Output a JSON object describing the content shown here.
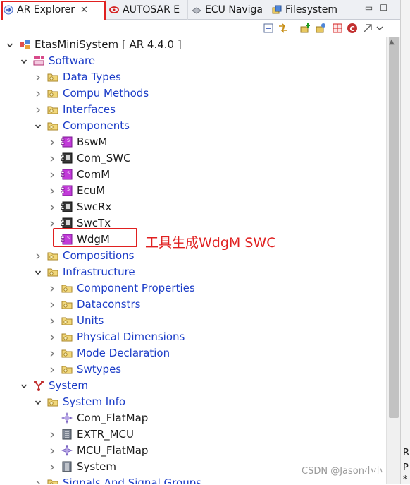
{
  "tabs": [
    {
      "label": "AR Explorer",
      "icon": "arrow-icon",
      "closable": true
    },
    {
      "label": "AUTOSAR E",
      "icon": "autosar-icon"
    },
    {
      "label": "ECU Naviga",
      "icon": "ecu-nav-icon"
    },
    {
      "label": "Filesystem",
      "icon": "filesystem-icon"
    }
  ],
  "window_buttons": {
    "minimize": "▭",
    "maximize": "☐"
  },
  "tree": [
    {
      "label": "EtasMiniSystem [ AR 4.4.0 ]",
      "color": "black",
      "icon": "project-icon",
      "expanded": true
    },
    {
      "label": "Software",
      "color": "blue",
      "icon": "software-icon",
      "expanded": true
    },
    {
      "label": "Data Types",
      "color": "blue",
      "icon": "package-folder-icon",
      "expanded": false
    },
    {
      "label": "Compu Methods",
      "color": "blue",
      "icon": "package-folder-icon",
      "expanded": false
    },
    {
      "label": "Interfaces",
      "color": "blue",
      "icon": "package-folder-icon",
      "expanded": false
    },
    {
      "label": "Components",
      "color": "blue",
      "icon": "package-folder-icon",
      "expanded": true
    },
    {
      "label": "BswM",
      "color": "black",
      "icon": "bsw-component-icon",
      "expanded": false
    },
    {
      "label": "Com_SWC",
      "color": "black",
      "icon": "swc-component-icon",
      "expanded": false
    },
    {
      "label": "ComM",
      "color": "black",
      "icon": "bsw-component-icon",
      "expanded": false
    },
    {
      "label": "EcuM",
      "color": "black",
      "icon": "bsw-component-icon",
      "expanded": false
    },
    {
      "label": "SwcRx",
      "color": "black",
      "icon": "swc-component-icon",
      "expanded": false
    },
    {
      "label": "SwcTx",
      "color": "black",
      "icon": "swc-component-icon",
      "expanded": false
    },
    {
      "label": "WdgM",
      "color": "black",
      "icon": "bsw-component-icon",
      "expanded": null
    },
    {
      "label": "Compositions",
      "color": "blue",
      "icon": "package-folder-icon",
      "expanded": false
    },
    {
      "label": "Infrastructure",
      "color": "blue",
      "icon": "package-folder-icon",
      "expanded": true
    },
    {
      "label": "Component Properties",
      "color": "blue",
      "icon": "package-folder-icon",
      "expanded": false
    },
    {
      "label": "Dataconstrs",
      "color": "blue",
      "icon": "package-folder-icon",
      "expanded": false
    },
    {
      "label": "Units",
      "color": "blue",
      "icon": "package-folder-icon",
      "expanded": false
    },
    {
      "label": "Physical Dimensions",
      "color": "blue",
      "icon": "package-folder-icon",
      "expanded": false
    },
    {
      "label": "Mode Declaration",
      "color": "blue",
      "icon": "package-folder-icon",
      "expanded": false
    },
    {
      "label": "Swtypes",
      "color": "blue",
      "icon": "package-folder-icon",
      "expanded": false
    },
    {
      "label": "System",
      "color": "blue",
      "icon": "system-icon",
      "expanded": true
    },
    {
      "label": "System Info",
      "color": "blue",
      "icon": "package-folder-icon",
      "expanded": true
    },
    {
      "label": "Com_FlatMap",
      "color": "black",
      "icon": "flatmap-icon",
      "expanded": null
    },
    {
      "label": "EXTR_MCU",
      "color": "black",
      "icon": "ecu-instance-icon",
      "expanded": false
    },
    {
      "label": "MCU_FlatMap",
      "color": "black",
      "icon": "flatmap-icon",
      "expanded": false
    },
    {
      "label": "System",
      "color": "black",
      "icon": "ecu-instance-icon",
      "expanded": false
    },
    {
      "label": "Signals And Signal Groups",
      "color": "blue",
      "icon": "package-folder-icon",
      "expanded": false
    }
  ],
  "annotation": "工具生成WdgM SWC",
  "watermark": "CSDN @Jason小小",
  "right_strip_text": [
    "R",
    "P",
    "*"
  ],
  "colors": {
    "link_blue": "#1b3cc7",
    "highlight_red": "#e02020",
    "folder_yellow": "#e8c860",
    "component_magenta": "#c23ad9"
  }
}
